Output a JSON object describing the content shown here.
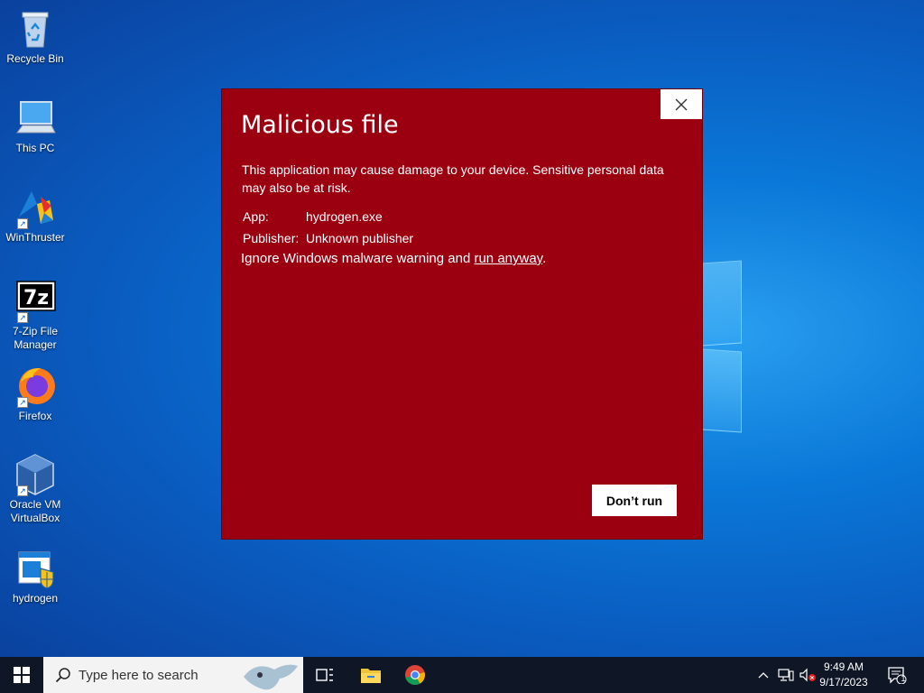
{
  "desktop": {
    "icons": [
      {
        "label": "Recycle Bin"
      },
      {
        "label": "This PC"
      },
      {
        "label": "WinThruster"
      },
      {
        "label": "7-Zip File Manager"
      },
      {
        "label": "Firefox"
      },
      {
        "label": "Oracle VM VirtualBox"
      },
      {
        "label": "hydrogen"
      }
    ]
  },
  "dialog": {
    "title": "Malicious file",
    "message": "This application may cause damage to your device. Sensitive personal data may also be at risk.",
    "app_label": "App:",
    "app_value": "hydrogen.exe",
    "publisher_label": "Publisher:",
    "publisher_value": "Unknown publisher",
    "ignore_prefix": "Ignore Windows malware warning and ",
    "ignore_link": "run anyway",
    "ignore_suffix": ".",
    "dont_run_label": "Don’t run",
    "background_color": "#9b0010"
  },
  "taskbar": {
    "search_placeholder": "Type here to search",
    "time": "9:49 AM",
    "date": "9/17/2023",
    "notification_count": "1"
  }
}
